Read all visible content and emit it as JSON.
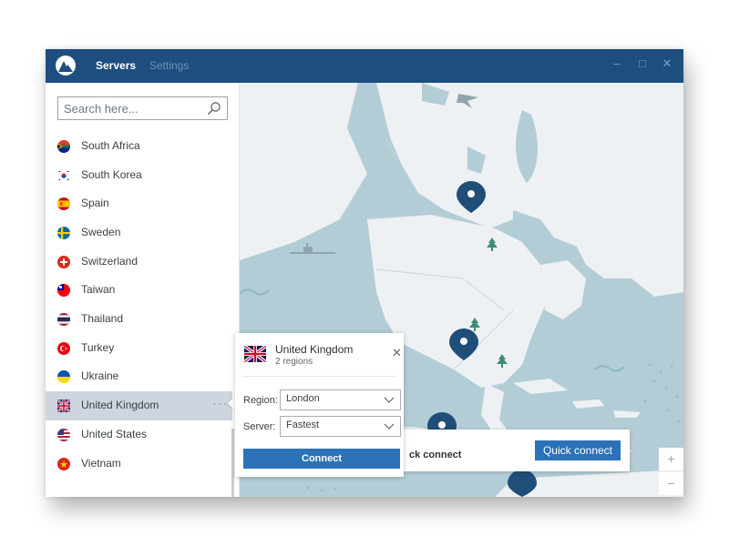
{
  "tabs": [
    {
      "label": "Servers",
      "active": true
    },
    {
      "label": "Settings",
      "active": false
    }
  ],
  "window_controls": [
    "minimize-icon",
    "maximize-icon",
    "close-icon"
  ],
  "search": {
    "placeholder": "Search here..."
  },
  "countries": [
    {
      "label": "South Africa"
    },
    {
      "label": "South Korea"
    },
    {
      "label": "Spain"
    },
    {
      "label": "Sweden"
    },
    {
      "label": "Switzerland"
    },
    {
      "label": "Taiwan"
    },
    {
      "label": "Thailand"
    },
    {
      "label": "Turkey"
    },
    {
      "label": "Ukraine"
    },
    {
      "label": "United Kingdom",
      "selected": true
    },
    {
      "label": "United States"
    },
    {
      "label": "Vietnam"
    }
  ],
  "popup": {
    "title": "United Kingdom",
    "subtitle": "2 regions",
    "region_label": "Region:",
    "region_value": "London",
    "server_label": "Server:",
    "server_value": "Fastest",
    "connect_label": "Connect"
  },
  "quick_connect": {
    "label": "ck connect",
    "button_label": "Quick connect"
  },
  "zoom": {
    "in_label": "+",
    "out_label": "−"
  },
  "colors": {
    "titlebar": "#1e4e80",
    "accent": "#2b72b8",
    "map_water": "#b3cdd6",
    "map_land": "#eef1f3",
    "pin": "#1f4f78",
    "selected_row": "#cdd5de"
  }
}
